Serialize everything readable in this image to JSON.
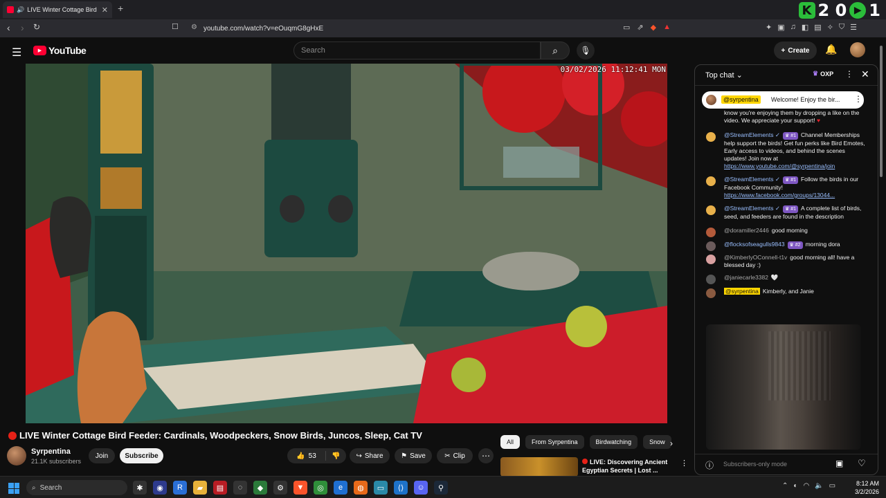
{
  "browser": {
    "tab_title": "LIVE Winter Cottage Bird F",
    "new_tab": "+",
    "url": "youtube.com/watch?v=eOuqmG8gHxE",
    "overlay_digits": "2 0",
    "overlay_count": "1"
  },
  "youtube": {
    "logo": "YouTube",
    "search_placeholder": "Search",
    "create_label": "Create"
  },
  "video": {
    "timestamp": "03/02/2026 11:12:41 MON",
    "title": "LIVE Winter Cottage Bird Feeder: Cardinals, Woodpeckers, Snow Birds, Juncos, Sleep, Cat TV"
  },
  "channel": {
    "name": "Syrpentina",
    "subscribers": "21.1K subscribers",
    "join": "Join",
    "subscribe": "Subscribe"
  },
  "actions": {
    "likes": "53",
    "share": "Share",
    "save": "Save",
    "clip": "Clip"
  },
  "recommendations": {
    "chips": [
      "All",
      "From Syrpentina",
      "Birdwatching",
      "Snow"
    ],
    "item_title": "LIVE: Discovering Ancient Egyptian Secrets | Lost ..."
  },
  "chat": {
    "mode": "Top chat",
    "oxp": "OXP",
    "pinned_author": "@syrpentina",
    "pinned_message": "Welcome! Enjoy the bir...",
    "messages": [
      {
        "author": "",
        "badge": "",
        "text": "know you're enjoying them by dropping a like on the video. We appreciate your support!",
        "link": ""
      },
      {
        "author": "@StreamElements ✓",
        "badge": "#1",
        "text": "Channel Memberships help support the birds! Get fun perks like Bird Emotes, Early access to videos, and behind the scenes updates! Join now at",
        "link": "https://www.youtube.com/@syrpentina/join"
      },
      {
        "author": "@StreamElements ✓",
        "badge": "#1",
        "text": "Follow the birds in our Facebook Community!",
        "link": "https://www.facebook.com/groups/13044..."
      },
      {
        "author": "@StreamElements ✓",
        "badge": "#1",
        "text": "A complete list of birds, seed, and feeders are found in the description",
        "link": ""
      },
      {
        "author": "@doramiller2446",
        "badge": "",
        "text": "good morning",
        "link": ""
      },
      {
        "author": "@flocksofseagulls9843",
        "badge": "#2",
        "text": "morning dora",
        "link": ""
      },
      {
        "author": "@KimberlyOConnell-t1v",
        "badge": "",
        "text": "good morning all! have a blessed day :)",
        "link": ""
      },
      {
        "author": "@janiecarle3382",
        "badge": "",
        "text": "🤍",
        "link": ""
      },
      {
        "author": "@syrpentina",
        "badge": "",
        "text": "Kimberly, and Janie",
        "link": ""
      }
    ],
    "input_placeholder": "Subscribers-only mode"
  },
  "taskbar": {
    "search_label": "Search",
    "time": "8:12 AM",
    "date": "3/2/2026"
  }
}
